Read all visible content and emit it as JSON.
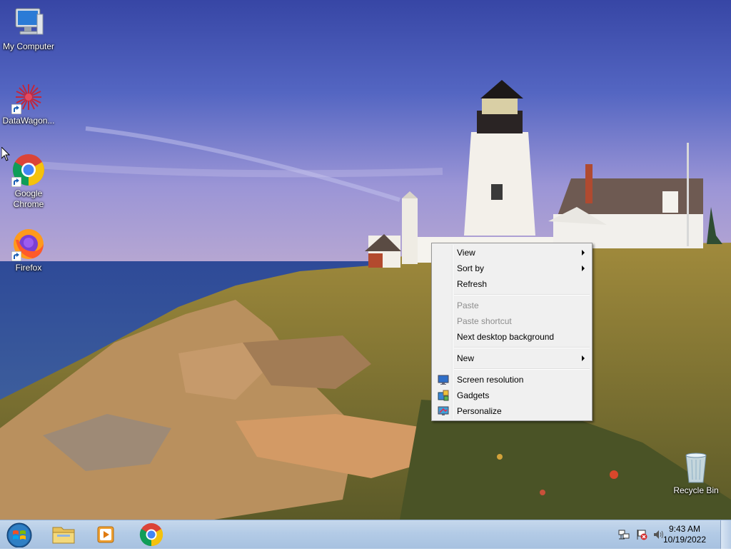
{
  "desktop": {
    "icons": [
      {
        "label": "My Computer",
        "icon": "computer-icon"
      },
      {
        "label": "DataWagon...",
        "icon": "datawagon-icon"
      },
      {
        "label": "Google Chrome",
        "icon": "chrome-icon"
      },
      {
        "label": "Firefox",
        "icon": "firefox-icon"
      },
      {
        "label": "Recycle Bin",
        "icon": "recycle-bin-icon"
      }
    ]
  },
  "context_menu": {
    "view": "View",
    "sort_by": "Sort by",
    "refresh": "Refresh",
    "paste": "Paste",
    "paste_shortcut": "Paste shortcut",
    "next_background": "Next desktop background",
    "new": "New",
    "screen_resolution": "Screen resolution",
    "gadgets": "Gadgets",
    "personalize": "Personalize"
  },
  "taskbar": {
    "pinned": [
      "start-orb-icon",
      "file-explorer-icon",
      "media-player-icon",
      "chrome-icon"
    ],
    "tray": [
      "network-icon",
      "action-center-icon",
      "volume-icon"
    ],
    "time": "9:43 AM",
    "date": "10/19/2022"
  },
  "colors": {
    "menu_bg": "#f0f0f0",
    "menu_disabled": "#8d8d8d",
    "taskbar": "#b3cbe6",
    "sky": "#4a5ab0"
  }
}
